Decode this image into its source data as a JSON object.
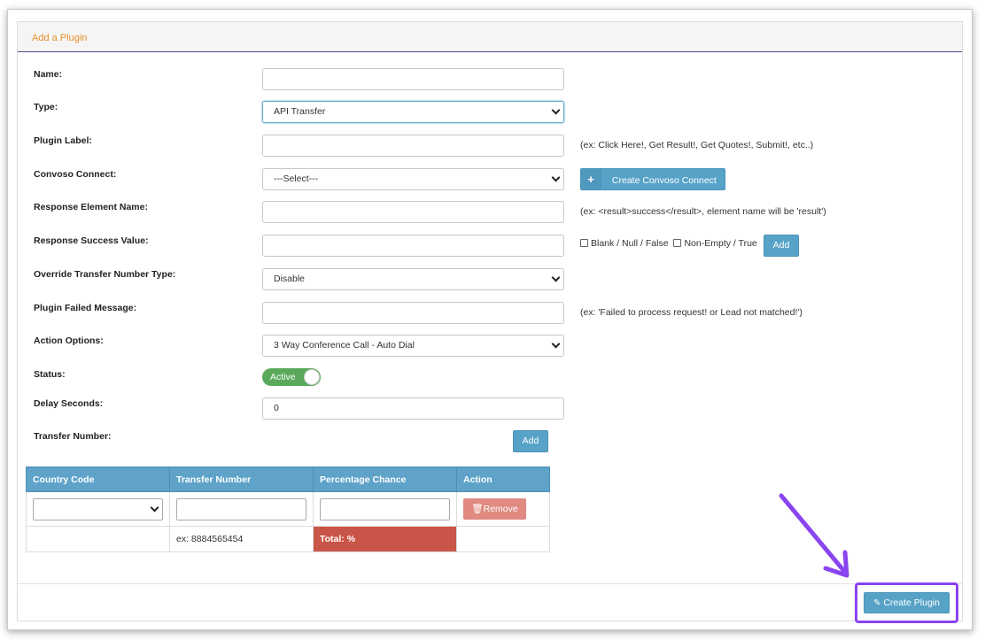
{
  "panel": {
    "title": "Add a Plugin"
  },
  "form": {
    "name": {
      "label": "Name:",
      "value": ""
    },
    "type": {
      "label": "Type:",
      "value": "API Transfer"
    },
    "plugin_label": {
      "label": "Plugin Label:",
      "value": "",
      "hint": "(ex: Click Here!, Get Result!, Get Quotes!, Submit!, etc..)"
    },
    "convoso_connect": {
      "label": "Convoso Connect:",
      "value": "---Select---",
      "button": "Create Convoso Connect"
    },
    "response_element": {
      "label": "Response Element Name:",
      "value": "",
      "hint": "(ex: <result>success</result>, element name will be 'result')"
    },
    "response_success": {
      "label": "Response Success Value:",
      "value": "",
      "checkbox1": "Blank / Null / False",
      "checkbox2": "Non-Empty / True",
      "add": "Add"
    },
    "override_transfer": {
      "label": "Override Transfer Number Type:",
      "value": "Disable"
    },
    "failed_message": {
      "label": "Plugin Failed Message:",
      "value": "",
      "hint": "(ex: 'Failed to process request! or Lead not matched!')"
    },
    "action_options": {
      "label": "Action Options:",
      "value": "3 Way Conference Call - Auto Dial"
    },
    "status": {
      "label": "Status:",
      "value": "Active"
    },
    "delay_seconds": {
      "label": "Delay Seconds:",
      "value": "0"
    },
    "transfer_number": {
      "label": "Transfer Number:",
      "add": "Add"
    }
  },
  "table": {
    "headers": [
      "Country Code",
      "Transfer Number",
      "Percentage Chance",
      "Action"
    ],
    "remove": "Remove",
    "example": "ex: 8884565454",
    "total": "Total: %"
  },
  "footer": {
    "create": "Create Plugin"
  },
  "colors": {
    "accent": "#57a3c8",
    "annotation": "#8a44f0",
    "total": "#c95548",
    "active": "#5aa95a"
  }
}
